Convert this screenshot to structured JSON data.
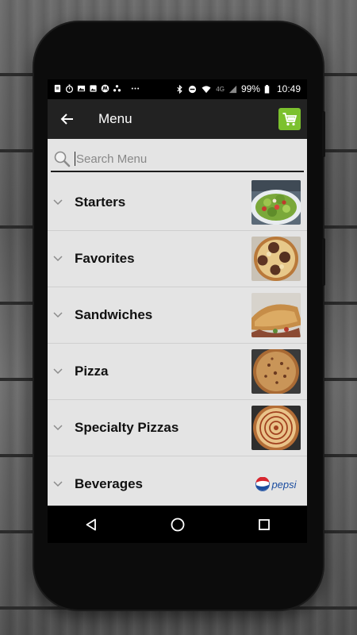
{
  "status_bar": {
    "network": "4G",
    "battery": "99%",
    "time": "10:49",
    "left_icons": [
      "file-icon",
      "stopwatch-icon",
      "gallery-icon",
      "image-icon",
      "motorola-icon",
      "share-icon",
      "more-icon"
    ],
    "right_icons": [
      "bluetooth-icon",
      "do-not-disturb-icon",
      "wifi-icon",
      "signal-icon",
      "battery-icon"
    ]
  },
  "app_bar": {
    "title": "Menu",
    "back_icon": "arrow-left-icon",
    "cart_icon": "shopping-cart-icon",
    "cart_color": "#7cc12e"
  },
  "search": {
    "placeholder": "Search Menu",
    "value": ""
  },
  "menu": {
    "items": [
      {
        "label": "Starters",
        "thumb": "salad"
      },
      {
        "label": "Favorites",
        "thumb": "meatball-pizza"
      },
      {
        "label": "Sandwiches",
        "thumb": "calzone"
      },
      {
        "label": "Pizza",
        "thumb": "pizza"
      },
      {
        "label": "Specialty Pizzas",
        "thumb": "specialty-pizza"
      },
      {
        "label": "Beverages",
        "thumb": "pepsi-logo",
        "brand": "pepsi"
      }
    ]
  },
  "nav_bar": {
    "buttons": [
      "back-triangle-icon",
      "home-circle-icon",
      "recents-square-icon"
    ]
  }
}
